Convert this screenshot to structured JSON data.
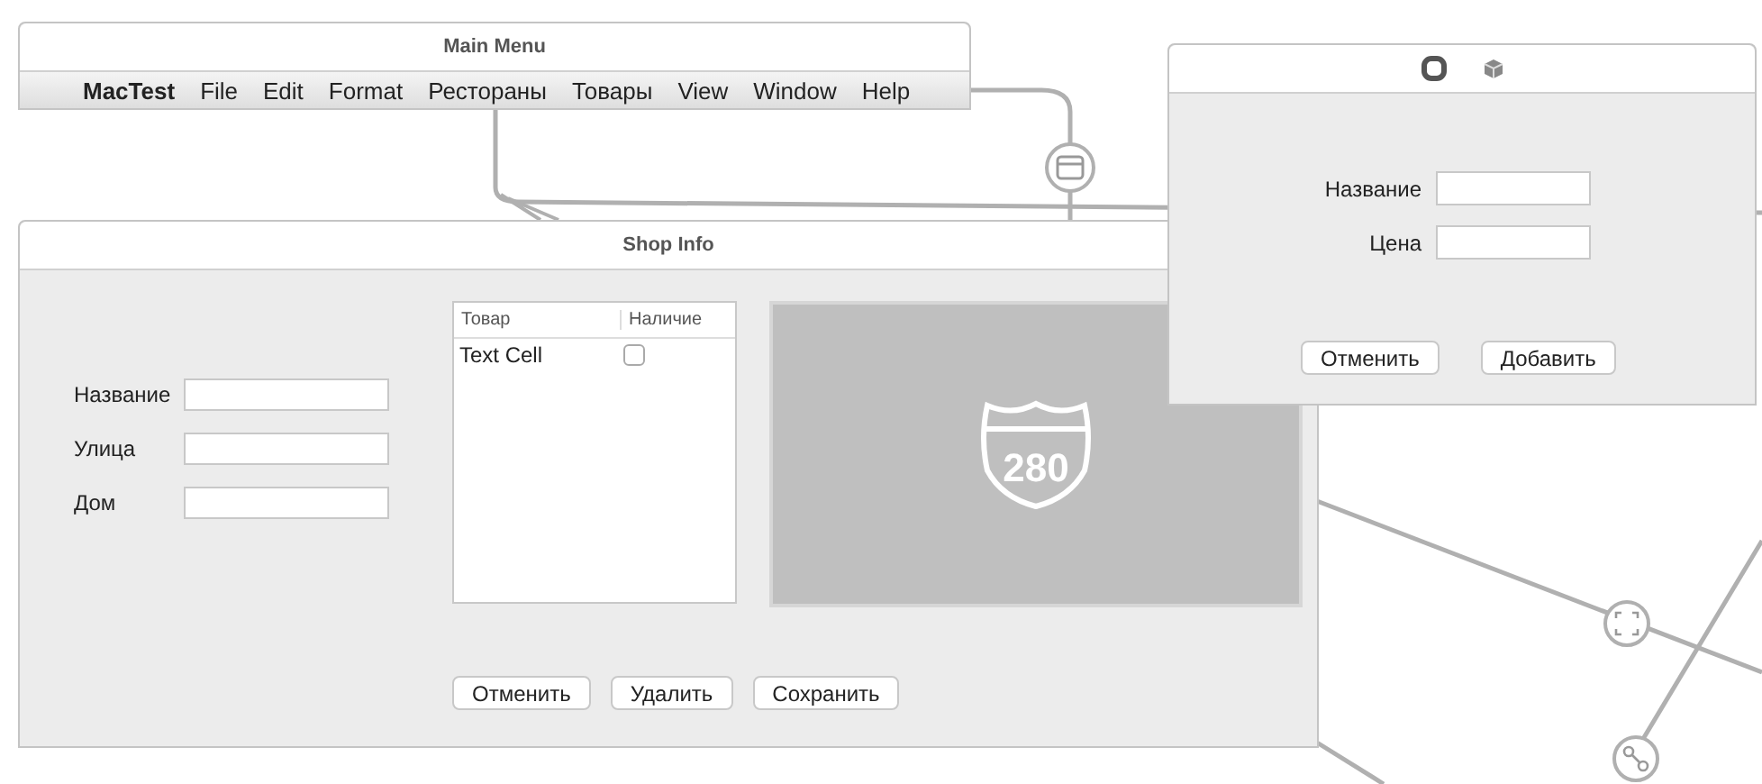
{
  "main_menu": {
    "title": "Main Menu",
    "items": [
      {
        "label": "MacTest",
        "kind": "app"
      },
      {
        "label": "File",
        "kind": "menu"
      },
      {
        "label": "Edit",
        "kind": "menu"
      },
      {
        "label": "Format",
        "kind": "menu"
      },
      {
        "label": "Рестораны",
        "kind": "menu"
      },
      {
        "label": "Товары",
        "kind": "menu"
      },
      {
        "label": "View",
        "kind": "menu"
      },
      {
        "label": "Window",
        "kind": "menu"
      },
      {
        "label": "Help",
        "kind": "menu"
      }
    ]
  },
  "shop_info": {
    "title": "Shop Info",
    "fields": [
      {
        "label": "Название"
      },
      {
        "label": "Улица"
      },
      {
        "label": "Дом"
      }
    ],
    "table": {
      "columns": [
        "Товар",
        "Наличие"
      ],
      "rows": [
        {
          "name": "Text Cell",
          "checked": false
        }
      ]
    },
    "image_badge": "280",
    "buttons": [
      "Отменить",
      "Удалить",
      "Сохранить"
    ]
  },
  "add_window": {
    "fields": [
      {
        "label": "Название"
      },
      {
        "label": "Цена"
      }
    ],
    "buttons": [
      "Отменить",
      "Добавить"
    ]
  }
}
